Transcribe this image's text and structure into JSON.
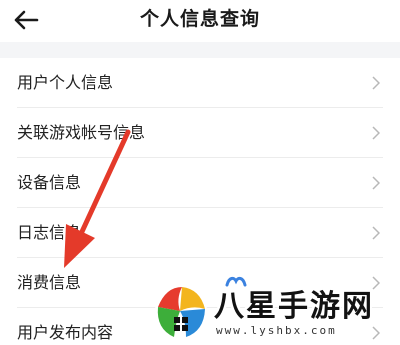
{
  "header": {
    "title": "个人信息查询",
    "back_icon": "arrow-left-icon"
  },
  "list": {
    "items": [
      {
        "label": "用户个人信息",
        "icon": "chevron-right-icon"
      },
      {
        "label": "关联游戏帐号信息",
        "icon": "chevron-right-icon"
      },
      {
        "label": "设备信息",
        "icon": "chevron-right-icon"
      },
      {
        "label": "日志信息",
        "icon": "chevron-right-icon"
      },
      {
        "label": "消费信息",
        "icon": "chevron-right-icon"
      },
      {
        "label": "用户发布内容",
        "icon": "chevron-right-icon"
      }
    ]
  },
  "annotation": {
    "arrow_color": "#e43a2a",
    "points_to": "消费信息"
  },
  "watermark": {
    "title": "八星手游网",
    "url": "www.lyshbx.com"
  },
  "colors": {
    "background": "#ffffff",
    "section_gap": "#f4f5f7",
    "text": "#222222",
    "chevron": "#b8b8b8"
  }
}
